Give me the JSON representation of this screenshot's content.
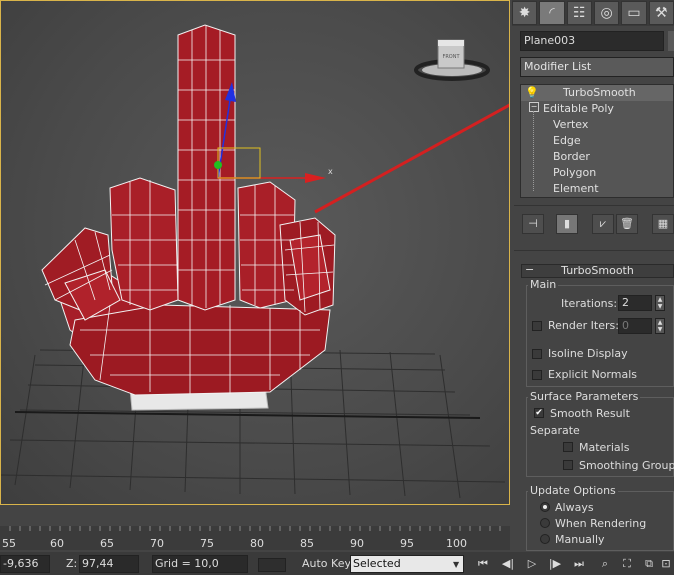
{
  "viewport": {
    "axis_x_label": "x",
    "viewcube_label": "FRONT"
  },
  "panel": {
    "tabs": [
      "create-tab",
      "modify-tab",
      "hierarchy-tab",
      "motion-tab",
      "display-tab",
      "utilities-tab"
    ],
    "object_name": "Plane003",
    "modifier_list": "Modifier List",
    "stack": {
      "modifier": "TurboSmooth",
      "base": "Editable Poly",
      "sub_objects": [
        "Vertex",
        "Edge",
        "Border",
        "Polygon",
        "Element"
      ]
    },
    "rollout_title": "TurboSmooth",
    "main": {
      "group": "Main",
      "iterations_label": "Iterations:",
      "iterations_value": "2",
      "render_iters_label": "Render Iters:",
      "render_iters_value": "0",
      "isoline_display": "Isoline Display",
      "explicit_normals": "Explicit Normals"
    },
    "surface": {
      "group": "Surface Parameters",
      "smooth_result": "Smooth Result",
      "separate": "Separate",
      "materials": "Materials",
      "smoothing_groups": "Smoothing Groups"
    },
    "update": {
      "group": "Update Options",
      "always": "Always",
      "when_rendering": "When Rendering",
      "manually": "Manually"
    }
  },
  "timeline": {
    "ticks": [
      "55",
      "60",
      "65",
      "70",
      "75",
      "80",
      "85",
      "90",
      "95",
      "100"
    ]
  },
  "status_bar": {
    "x_value": "-9,636",
    "z_label": "Z:",
    "z_value": "97,44",
    "grid": "Grid = 10,0",
    "auto_key": "Auto Key",
    "selected": "Selected"
  }
}
